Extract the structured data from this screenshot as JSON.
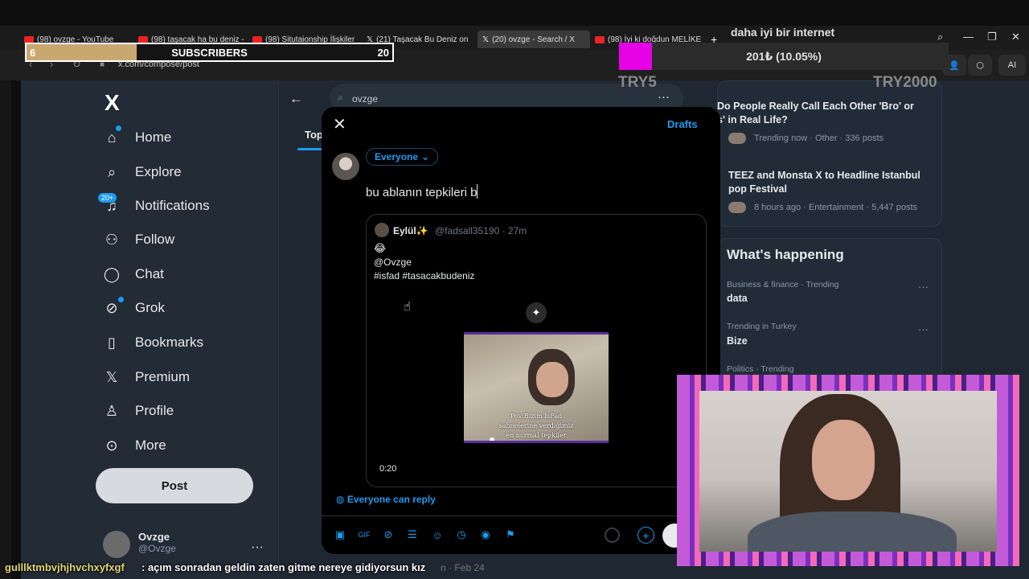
{
  "browser": {
    "tabs": [
      {
        "label": "(98) ovzge - YouTube",
        "icon": "youtube-icon"
      },
      {
        "label": "(98) taşacak ha bu deniz -",
        "icon": "youtube-icon"
      },
      {
        "label": "(98) Situtaionship İlişkiler",
        "icon": "youtube-icon"
      },
      {
        "label": "(21) Taşacak Bu Deniz on",
        "icon": "x-icon"
      },
      {
        "label": "(20) ovzge - Search / X",
        "icon": "x-icon"
      },
      {
        "label": "(98) İyi ki doğdun MELİKE",
        "icon": "youtube-icon"
      }
    ],
    "url": "x.com/compose/post",
    "ai_label": "AI"
  },
  "overlay": {
    "subs_count": "6",
    "subs_label": "SUBSCRIBERS",
    "subs_goal": "20",
    "subs_progress": 0.3,
    "goal_title": "daha iyi bir internet",
    "goal_amount": "201₺ (10.05%)",
    "goal_progress": 0.1005,
    "goal_min": "TRY5",
    "goal_max": "TRY2000",
    "chat_user": "gulllktmbvjhjhvchxyfxgf",
    "chat_msg": ": açım sonradan geldin zaten gitme nereye gidiyorsun kız"
  },
  "sidebar": {
    "logo": "X",
    "badge": "20+",
    "items": [
      {
        "label": "Home",
        "icon": "home-icon"
      },
      {
        "label": "Explore",
        "icon": "search-icon"
      },
      {
        "label": "Notifications",
        "icon": "bell-icon"
      },
      {
        "label": "Follow",
        "icon": "follow-icon"
      },
      {
        "label": "Chat",
        "icon": "chat-icon"
      },
      {
        "label": "Grok",
        "icon": "grok-icon"
      },
      {
        "label": "Bookmarks",
        "icon": "bookmark-icon"
      },
      {
        "label": "Premium",
        "icon": "x-icon"
      },
      {
        "label": "Profile",
        "icon": "profile-icon"
      },
      {
        "label": "More",
        "icon": "more-icon"
      }
    ],
    "post_label": "Post",
    "account_name": "Ovzge",
    "account_handle": "@Ovzge"
  },
  "main": {
    "search_value": "ovzge",
    "tab_label": "Top"
  },
  "modal": {
    "drafts": "Drafts",
    "audience": "Everyone",
    "text": "bu ablanın tepkileri b",
    "quote": {
      "name": "Eylül✨",
      "meta": "@fadsall35190 · 27m",
      "emoji": "😂",
      "line1": "@Ovzge",
      "line2": "#isfad #tasacakbudeniz",
      "caption1": "Pov:Bizim İsFad",
      "caption2": "sahnelerine verdiğimiz",
      "caption3": "en normal tepkiler",
      "duration": "0:20"
    },
    "reply_setting": "Everyone can reply"
  },
  "right": {
    "trends_top": [
      {
        "title": "Do People Really Call Each Other 'Bro' or",
        "title2": "s' in Real Life?",
        "meta": "Trending now · Other · 336 posts"
      },
      {
        "title": "TEEZ and Monsta X to Headline Istanbul",
        "title2": "pop Festival",
        "meta": "8 hours ago · Entertainment · 5,447 posts"
      }
    ],
    "whats_happening": "What's happening",
    "trends": [
      {
        "ctx": "Business & finance · Trending",
        "name": "data"
      },
      {
        "ctx": "Trending in Turkey",
        "name": "Bize"
      },
      {
        "ctx": "Politics · Trending",
        "name": ""
      }
    ]
  },
  "feed_meta": "n · Feb 24",
  "colors": {
    "accent": "#1d9bf0",
    "goal": "#e600e6",
    "sub_fill": "#c9a870",
    "cam_frame": "#7a2fbf"
  }
}
